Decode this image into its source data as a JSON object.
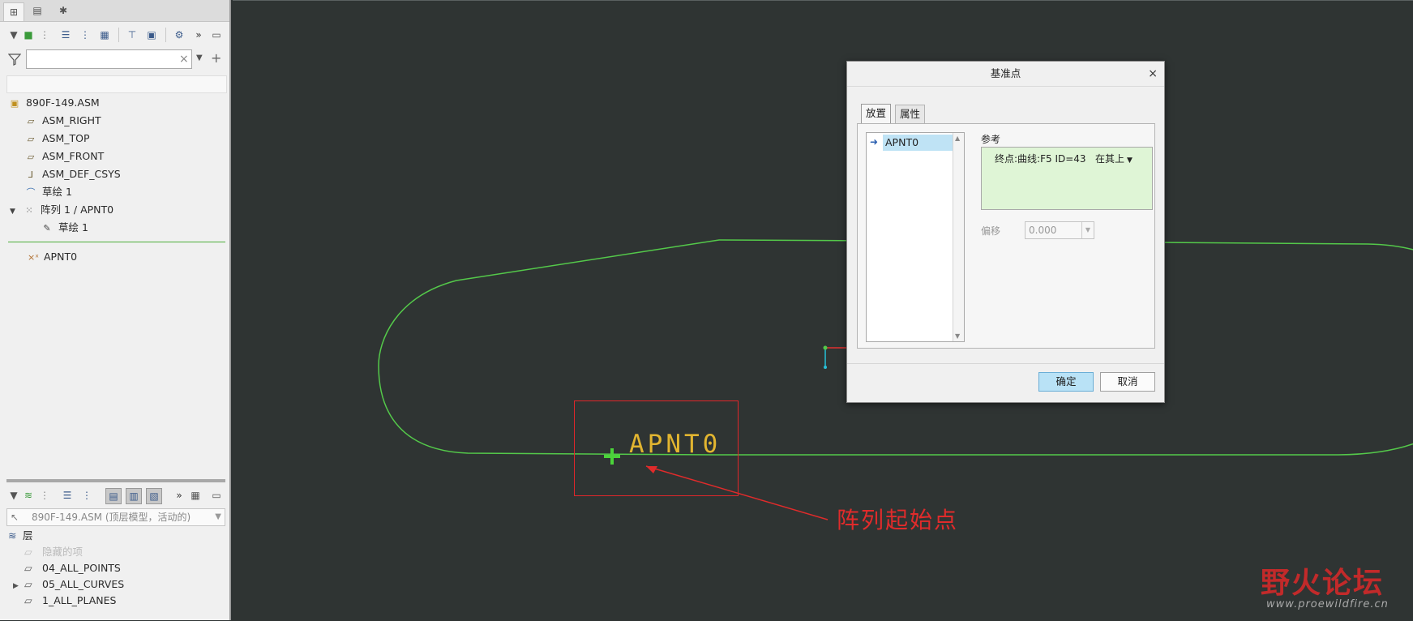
{
  "tree": {
    "items": [
      {
        "label": "890F-149.ASM"
      },
      {
        "label": "ASM_RIGHT"
      },
      {
        "label": "ASM_TOP"
      },
      {
        "label": "ASM_FRONT"
      },
      {
        "label": "ASM_DEF_CSYS"
      },
      {
        "label": "草绘 1"
      },
      {
        "label": "阵列 1 / APNT0"
      },
      {
        "label": "草绘 1"
      },
      {
        "label": "APNT0"
      }
    ]
  },
  "layers": {
    "selector": "890F-149.ASM (顶层模型，活动的)",
    "header": "层",
    "items": [
      {
        "label": "隐藏的项"
      },
      {
        "label": "04_ALL_POINTS"
      },
      {
        "label": "05_ALL_CURVES"
      },
      {
        "label": "1_ALL_PLANES"
      }
    ]
  },
  "dialog": {
    "title": "基准点",
    "close": "×",
    "tabs": [
      {
        "label": "放置"
      },
      {
        "label": "属性"
      }
    ],
    "list_item": "APNT0",
    "ref_label": "参考",
    "ref_value": "终点:曲线:F5 ID=43",
    "ref_mode": "在其上",
    "offset_label": "偏移",
    "offset_value": "0.000",
    "ok": "确定",
    "cancel": "取消"
  },
  "viewport": {
    "point_label": "APNT0",
    "annotation": "阵列起始点"
  },
  "watermark": {
    "logo": "野火论坛",
    "url": "www.proewildfire.cn"
  },
  "colors": {
    "curve": "#54c94a",
    "annotation": "#e02b2b",
    "point_label": "#e2b530"
  }
}
